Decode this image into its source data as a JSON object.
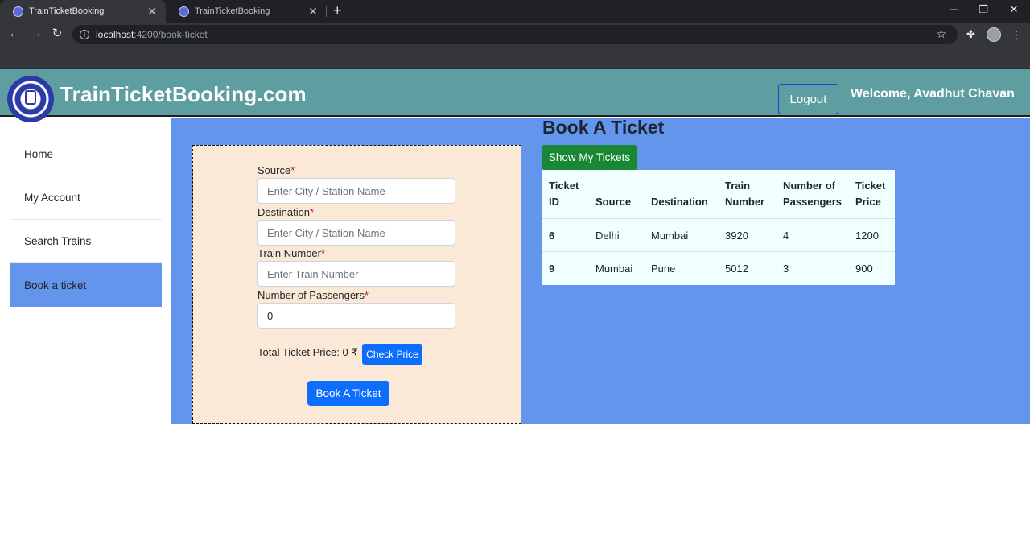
{
  "browser": {
    "tabs": [
      {
        "title": "TrainTicketBooking",
        "active": true
      },
      {
        "title": "TrainTicketBooking",
        "active": false
      }
    ],
    "url_host": "localhost",
    "url_path": ":4200/book-ticket"
  },
  "header": {
    "brand": "TrainTicketBooking.com",
    "logout_label": "Logout",
    "welcome": "Welcome, Avadhut Chavan"
  },
  "sidebar": {
    "items": [
      {
        "label": "Home",
        "active": false
      },
      {
        "label": "My Account",
        "active": false
      },
      {
        "label": "Search Trains",
        "active": false
      },
      {
        "label": "Book a ticket",
        "active": true
      }
    ]
  },
  "form": {
    "source_label": "Source",
    "source_placeholder": "Enter City / Station Name",
    "destination_label": "Destination",
    "destination_placeholder": "Enter City / Station Name",
    "train_number_label": "Train Number",
    "train_number_placeholder": "Enter Train Number",
    "passengers_label": "Number of Passengers",
    "passengers_value": "0",
    "required_mark": "*",
    "total_price_text": "Total Ticket Price: 0 ₹",
    "check_price_label": "Check Price",
    "book_label": "Book A Ticket"
  },
  "main": {
    "title": "Book A Ticket",
    "show_tickets_label": "Show My Tickets"
  },
  "table": {
    "headers": [
      [
        "Ticket",
        "ID"
      ],
      [
        "Source"
      ],
      [
        "Destination"
      ],
      [
        "Train",
        "Number"
      ],
      [
        "Number of",
        "Passengers"
      ],
      [
        "Ticket",
        "Price"
      ]
    ],
    "rows": [
      [
        "6",
        "Delhi",
        "Mumbai",
        "3920",
        "4",
        "1200"
      ],
      [
        "9",
        "Mumbai",
        "Pune",
        "5012",
        "3",
        "900"
      ]
    ]
  },
  "colors": {
    "header_bg": "#5f9ea0",
    "main_bg": "#6495ed",
    "form_bg": "#fbe9d8",
    "primary": "#0d6efd",
    "success": "#198733"
  }
}
